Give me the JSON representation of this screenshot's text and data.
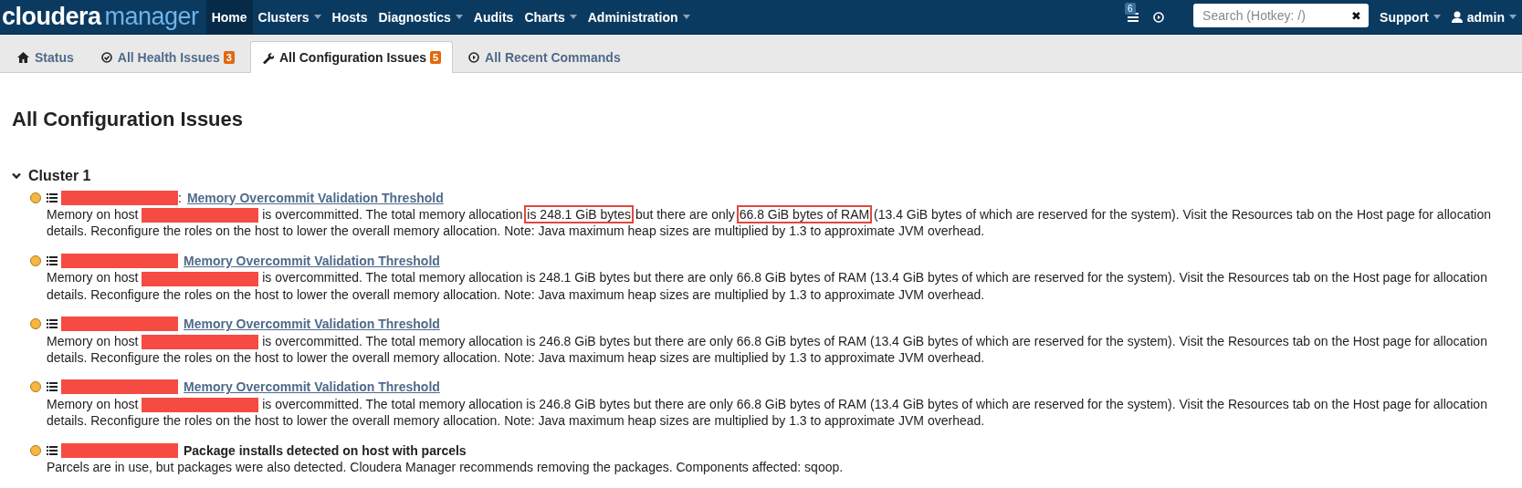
{
  "navbar": {
    "logo": {
      "brand": "cloudera",
      "product": "manager"
    },
    "items": [
      {
        "label": "Home",
        "selected": true,
        "has_menu": false
      },
      {
        "label": "Clusters",
        "selected": false,
        "has_menu": true
      },
      {
        "label": "Hosts",
        "selected": false,
        "has_menu": false
      },
      {
        "label": "Diagnostics",
        "selected": false,
        "has_menu": true
      },
      {
        "label": "Audits",
        "selected": false,
        "has_menu": false
      },
      {
        "label": "Charts",
        "selected": false,
        "has_menu": true
      },
      {
        "label": "Administration",
        "selected": false,
        "has_menu": true
      }
    ],
    "notification_count": "6",
    "search": {
      "placeholder": "Search (Hotkey: /)",
      "clear": "✖"
    },
    "support": "Support",
    "user": "admin"
  },
  "tabs": [
    {
      "label": "Status",
      "kind": "home",
      "selected": false
    },
    {
      "label": "All Health Issues",
      "kind": "health",
      "badge": "3",
      "selected": false
    },
    {
      "label": "All Configuration Issues",
      "kind": "configuration",
      "badge": "5",
      "selected": true
    },
    {
      "label": "All Recent Commands",
      "kind": "commands",
      "selected": false
    }
  ],
  "page_title": "All Configuration Issues",
  "cluster": {
    "name": "Cluster 1",
    "expanded": true,
    "issues": [
      {
        "title": "Memory Overcommit Validation Threshold",
        "kind": "link",
        "separator": ":",
        "description": [
          {
            "kind": "text",
            "text": "Memory on host"
          },
          {
            "kind": "redacted"
          },
          {
            "kind": "text",
            "text": "is overcommitted. The total memory allocation"
          },
          {
            "kind": "boxed",
            "text": "is 248.1 GiB bytes"
          },
          {
            "kind": "text",
            "text": "but there are only"
          },
          {
            "kind": "boxed",
            "text": "66.8 GiB bytes of RAM"
          },
          {
            "kind": "text",
            "text": "(13.4 GiB bytes of which are reserved for the system). Visit the Resources tab on the Host page for allocation details. Reconfigure the roles on the host to lower the overall memory allocation. Note: Java maximum heap sizes are multiplied by 1.3 to approximate JVM overhead."
          }
        ]
      },
      {
        "title": "Memory Overcommit Validation Threshold",
        "kind": "link",
        "description": [
          {
            "kind": "text",
            "text": "Memory on host"
          },
          {
            "kind": "redacted"
          },
          {
            "kind": "text",
            "text": "is overcommitted. The total memory allocation is 248.1 GiB bytes but there are only 66.8 GiB bytes of RAM (13.4 GiB bytes of which are reserved for the system). Visit the Resources tab on the Host page for allocation details. Reconfigure the roles on the host to lower the overall memory allocation. Note: Java maximum heap sizes are multiplied by 1.3 to approximate JVM overhead."
          }
        ]
      },
      {
        "title": "Memory Overcommit Validation Threshold",
        "kind": "link",
        "description": [
          {
            "kind": "text",
            "text": "Memory on host"
          },
          {
            "kind": "redacted"
          },
          {
            "kind": "text",
            "text": "is overcommitted. The total memory allocation is 246.8 GiB bytes but there are only 66.8 GiB bytes of RAM (13.4 GiB bytes of which are reserved for the system). Visit the Resources tab on the Host page for allocation details. Reconfigure the roles on the host to lower the overall memory allocation. Note: Java maximum heap sizes are multiplied by 1.3 to approximate JVM overhead."
          }
        ]
      },
      {
        "title": "Memory Overcommit Validation Threshold",
        "kind": "link",
        "description": [
          {
            "kind": "text",
            "text": "Memory on host"
          },
          {
            "kind": "redacted"
          },
          {
            "kind": "text",
            "text": "is overcommitted. The total memory allocation is 246.8 GiB bytes but there are only 66.8 GiB bytes of RAM (13.4 GiB bytes of which are reserved for the system). Visit the Resources tab on the Host page for allocation details. Reconfigure the roles on the host to lower the overall memory allocation. Note: Java maximum heap sizes are multiplied by 1.3 to approximate JVM overhead."
          }
        ]
      },
      {
        "title": "Package installs detected on host with parcels",
        "kind": "text",
        "description": [
          {
            "kind": "text",
            "text": "Parcels are in use, but packages were also detected. Cloudera Manager recommends removing the packages. Components affected: sqoop."
          }
        ]
      }
    ]
  }
}
